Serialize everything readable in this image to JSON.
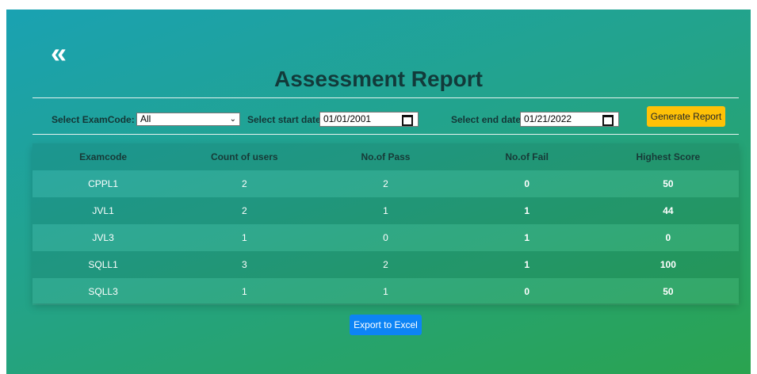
{
  "header": {
    "back_icon": "double-chevron-left-icon",
    "title": "Assessment Report"
  },
  "filters": {
    "exam_code_label": "Select ExamCode:",
    "exam_code_value": "All",
    "start_label": "Select start date:",
    "start_value": "01/01/2001",
    "end_label": "Select end date:",
    "end_value": "01/21/2022",
    "generate_label": "Generate Report"
  },
  "table": {
    "headers": [
      "Examcode",
      "Count of users",
      "No.of Pass",
      "No.of Fail",
      "Highest Score"
    ],
    "rows": [
      [
        "CPPL1",
        "2",
        "2",
        "0",
        "50"
      ],
      [
        "JVL1",
        "2",
        "1",
        "1",
        "44"
      ],
      [
        "JVL3",
        "1",
        "0",
        "1",
        "0"
      ],
      [
        "SQLL1",
        "3",
        "2",
        "1",
        "100"
      ],
      [
        "SQLL3",
        "1",
        "1",
        "0",
        "50"
      ]
    ]
  },
  "export_label": "Export to Excel",
  "colors": {
    "generate": "#ffc107",
    "export": "#0d84f5"
  }
}
